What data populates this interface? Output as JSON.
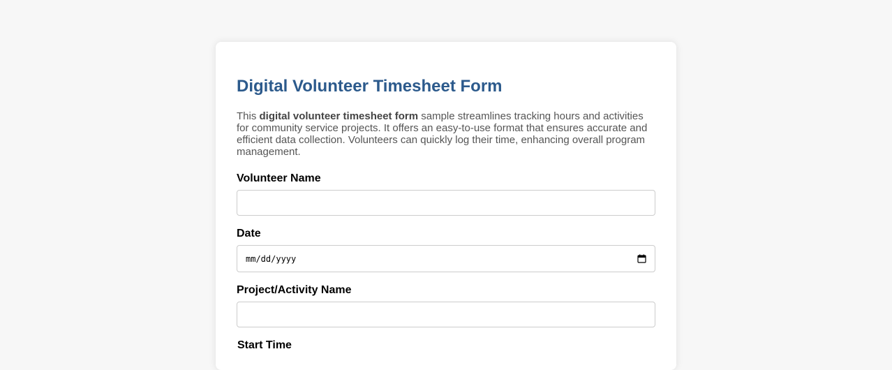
{
  "form": {
    "title": "Digital Volunteer Timesheet Form",
    "description": {
      "prefix": "This ",
      "bold": "digital volunteer timesheet form",
      "suffix": " sample streamlines tracking hours and activities for community service projects. It offers an easy-to-use format that ensures accurate and efficient data collection. Volunteers can quickly log their time, enhancing overall program management."
    },
    "fields": {
      "volunteer_name": {
        "label": "Volunteer Name",
        "value": "",
        "placeholder": ""
      },
      "date": {
        "label": "Date",
        "placeholder": "mm/dd/yyyy",
        "icon": "calendar-icon"
      },
      "project_name": {
        "label": "Project/Activity Name",
        "value": "",
        "placeholder": ""
      },
      "start_time": {
        "label": "Start Time"
      }
    }
  },
  "colors": {
    "page_background": "#f7f7f7",
    "card_background": "#ffffff",
    "title": "#2c5a8c",
    "description_text": "#555555",
    "field_border": "#cccccc"
  }
}
